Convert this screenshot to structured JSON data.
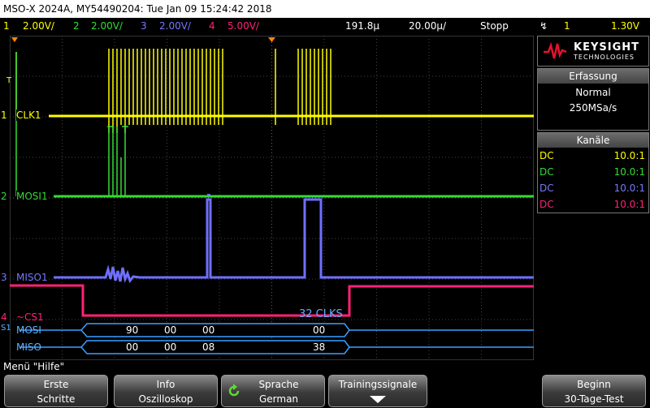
{
  "titlebar": {
    "text": "MSO-X 2024A, MY54490204: Tue Jan 09 15:24:42 2018"
  },
  "channels": [
    {
      "num": "1",
      "scale": "2.00V/",
      "color": "#ffff00"
    },
    {
      "num": "2",
      "scale": "2.00V/",
      "color": "#33dd33"
    },
    {
      "num": "3",
      "scale": "2.00V/",
      "color": "#7777ff"
    },
    {
      "num": "4",
      "scale": "5.00V/",
      "color": "#ff2277"
    }
  ],
  "timebase": {
    "delay": "191.8µ",
    "scale": "20.00µ/",
    "status": "Stopp",
    "trigger_source": "1",
    "trigger_level": "1.30V"
  },
  "trace_labels": {
    "t_marker": "T",
    "clk": "CLK1",
    "mosi": "MOSI1",
    "miso": "MISO1",
    "cs": "~CS1",
    "bus_mosi": "MOSI",
    "bus_miso": "MISO",
    "ch1": "1",
    "ch2": "2",
    "ch3": "3",
    "ch4": "4",
    "s": "S1",
    "clk_count": "32 CLKS"
  },
  "decode": {
    "mosi_bytes": [
      "90",
      "00",
      "00",
      "00"
    ],
    "miso_bytes": [
      "00",
      "00",
      "08",
      "38"
    ]
  },
  "logo": {
    "brand": "KEYSIGHT",
    "sub": "TECHNOLOGIES"
  },
  "acquisition": {
    "header": "Erfassung",
    "mode": "Normal",
    "rate": "250MSa/s"
  },
  "channels_panel": {
    "header": "Kanäle",
    "rows": [
      {
        "coupling": "DC",
        "probe": "10.0:1",
        "color": "#ffff00"
      },
      {
        "coupling": "DC",
        "probe": "10.0:1",
        "color": "#33dd33"
      },
      {
        "coupling": "DC",
        "probe": "10.0:1",
        "color": "#7777ff"
      },
      {
        "coupling": "DC",
        "probe": "10.0:1",
        "color": "#ff2277"
      }
    ]
  },
  "menu": {
    "title": "Menü \"Hilfe\""
  },
  "softkeys": [
    {
      "line1": "Erste",
      "line2": "Schritte"
    },
    {
      "line1": "Info",
      "line2": "Oszilloskop"
    },
    {
      "line1": "Sprache",
      "line2": "German"
    },
    {
      "line1": "Trainingssignale",
      "line2": ""
    },
    {
      "line1": "Beginn",
      "line2": "30-Tage-Test"
    }
  ]
}
